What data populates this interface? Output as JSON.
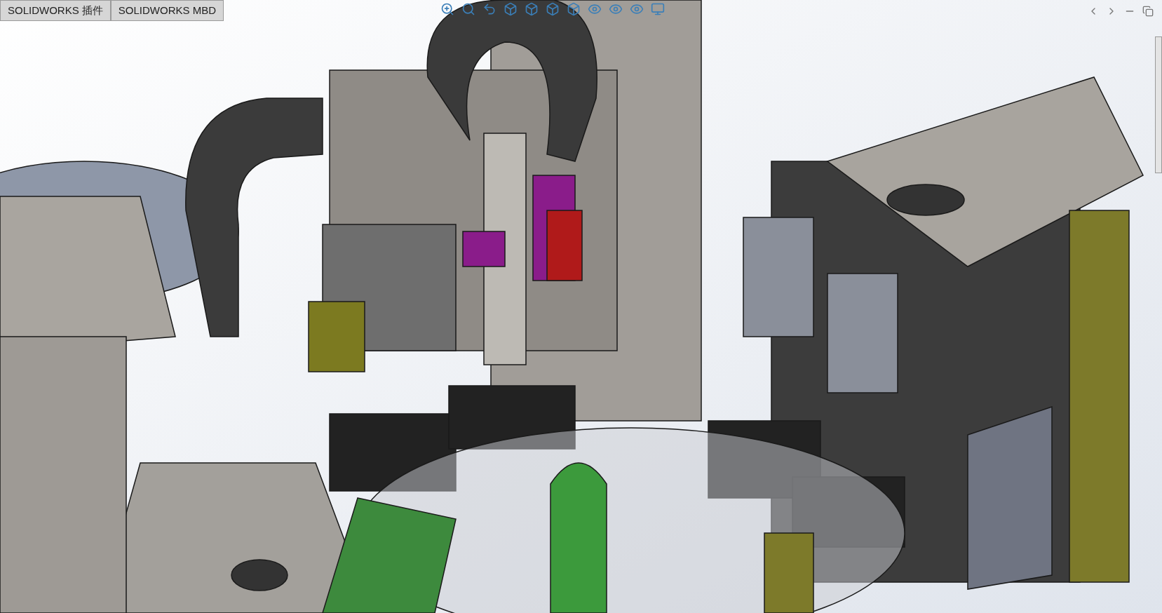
{
  "command_tabs": [
    {
      "label": "SOLIDWORKS 插件",
      "selected": false
    },
    {
      "label": "SOLIDWORKS MBD",
      "selected": false
    }
  ]
}
